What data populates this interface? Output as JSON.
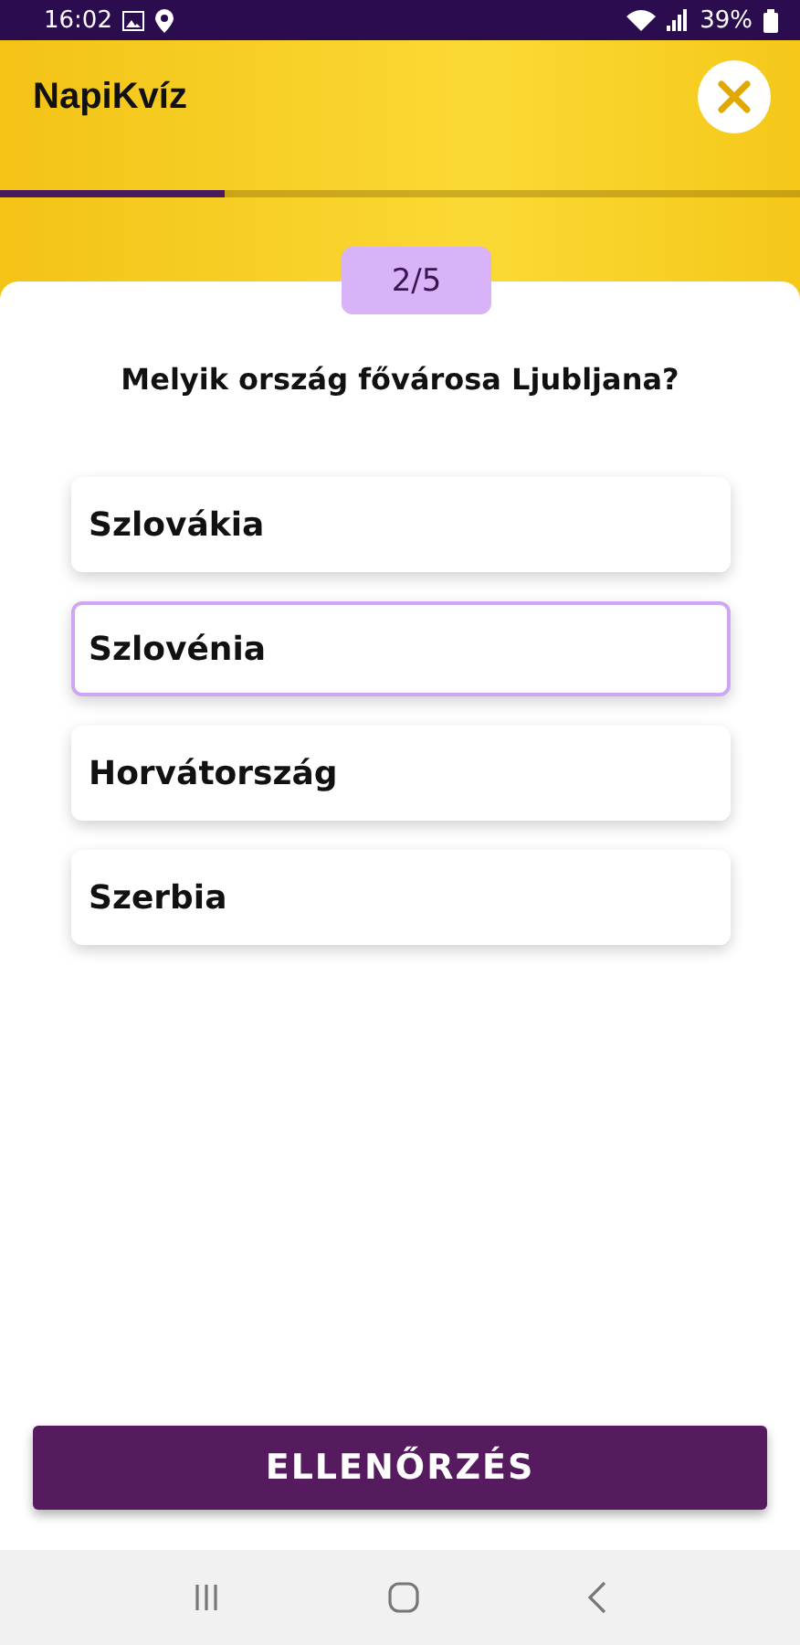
{
  "status_bar": {
    "time": "16:02",
    "battery": "39%"
  },
  "header": {
    "title": "NapiKvíz",
    "progress": {
      "level": 0.28
    }
  },
  "counter": "2/5",
  "question": "Melyik ország fővárosa Ljubljana?",
  "options": [
    {
      "label": "Szlovákia",
      "selected": false
    },
    {
      "label": "Szlovénia",
      "selected": true
    },
    {
      "label": "Horvátország",
      "selected": false
    },
    {
      "label": "Szerbia",
      "selected": false
    }
  ],
  "check_button": "ELLENŐRZÉS"
}
